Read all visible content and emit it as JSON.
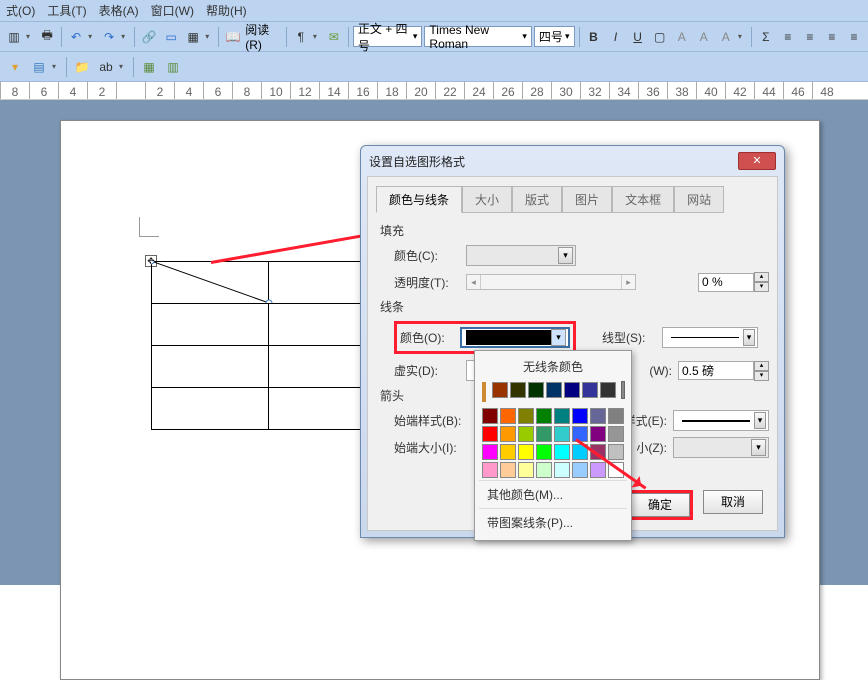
{
  "menu": {
    "o": "式(O)",
    "t": "工具(T)",
    "a": "表格(A)",
    "w": "窗口(W)",
    "h": "帮助(H)"
  },
  "toolbar": {
    "read": "阅读(R)",
    "style": "正文 + 四号",
    "font": "Times New Roman",
    "size": "四号"
  },
  "ruler_nums": [
    "8",
    "6",
    "4",
    "2",
    "",
    "2",
    "4",
    "6",
    "8",
    "10",
    "12",
    "14",
    "16",
    "18",
    "20",
    "22",
    "24",
    "26",
    "28",
    "30",
    "32",
    "34",
    "36",
    "38",
    "40",
    "42",
    "44",
    "46",
    "48"
  ],
  "dialog": {
    "title": "设置自选图形格式",
    "tabs": [
      "颜色与线条",
      "大小",
      "版式",
      "图片",
      "文本框",
      "网站"
    ],
    "fill_section": "填充",
    "color_label": "颜色(C):",
    "transparency_label": "透明度(T):",
    "transparency_value": "0 %",
    "line_section": "线条",
    "line_color_label": "颜色(O):",
    "line_type_label": "线型(S):",
    "dash_label": "虚实(D):",
    "weight_label_suffix": "(W):",
    "weight_value": "0.5 磅",
    "arrow_section": "箭头",
    "begin_style": "始端样式(B):",
    "begin_size": "始端大小(I):",
    "end_style_suffix": "样式(E):",
    "end_size_suffix": "小(Z):",
    "ok": "确定",
    "cancel": "取消"
  },
  "color_popup": {
    "title": "无线条颜色",
    "more": "其他颜色(M)...",
    "pattern": "带图案线条(P)...",
    "colors": [
      [
        "#000000",
        "#993300",
        "#333300",
        "#003300",
        "#003366",
        "#000080",
        "#333399",
        "#333333"
      ],
      [
        "#800000",
        "#ff6600",
        "#808000",
        "#008000",
        "#008080",
        "#0000ff",
        "#666699",
        "#808080"
      ],
      [
        "#ff0000",
        "#ff9900",
        "#99cc00",
        "#339966",
        "#33cccc",
        "#3366ff",
        "#800080",
        "#969696"
      ],
      [
        "#ff00ff",
        "#ffcc00",
        "#ffff00",
        "#00ff00",
        "#00ffff",
        "#00ccff",
        "#993366",
        "#c0c0c0"
      ],
      [
        "#ff99cc",
        "#ffcc99",
        "#ffff99",
        "#ccffcc",
        "#ccffff",
        "#99ccff",
        "#cc99ff",
        "#ffffff"
      ]
    ]
  }
}
